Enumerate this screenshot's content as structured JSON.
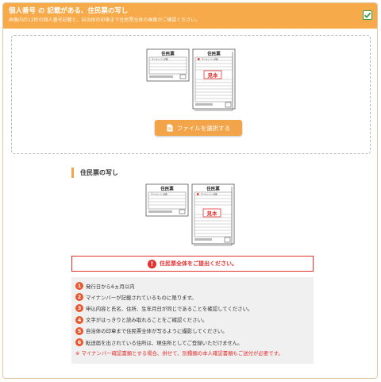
{
  "header": {
    "title": "個人番号 の 記載がある、住民票の写し",
    "subtitle": "画像内の12桁の個人番号記載と、自治体の印章まで住民票全体の画像かご確認ください。",
    "checked": true
  },
  "upload": {
    "doc_title": "住民票",
    "stamp_mynumber": "マイナンバー記載",
    "stamp_sample": "見本",
    "button_label": "ファイルを選択する"
  },
  "section": {
    "title": "住民票の写し"
  },
  "alert": {
    "text": "住民票全体をご提出ください。"
  },
  "notes": {
    "items": [
      {
        "num": "1",
        "text": "発行日から6ヵ月以内"
      },
      {
        "num": "2",
        "text": "マイナンバーが記載されているものに限ります。"
      },
      {
        "num": "3",
        "text": "申込内容と氏名、住所、生年月日が同じであることを確認してください。"
      },
      {
        "num": "4",
        "text": "文字がはっきりと読み取れることをご確認ください。"
      },
      {
        "num": "5",
        "text": "自治体の印章まで住民票全体が写るように撮影してください。"
      },
      {
        "num": "6",
        "text": "転送届を出されている住所は、現住所としてご登録いただけません。"
      }
    ],
    "warning": "※ マイナンバー確認書類とする場合、併せて、別種類の本人確認書類もご送付が必要です。"
  },
  "colors": {
    "header": "#f7aa4a",
    "accent": "#f3a449",
    "alert": "#e53030",
    "number_badge": "#e9572e"
  }
}
